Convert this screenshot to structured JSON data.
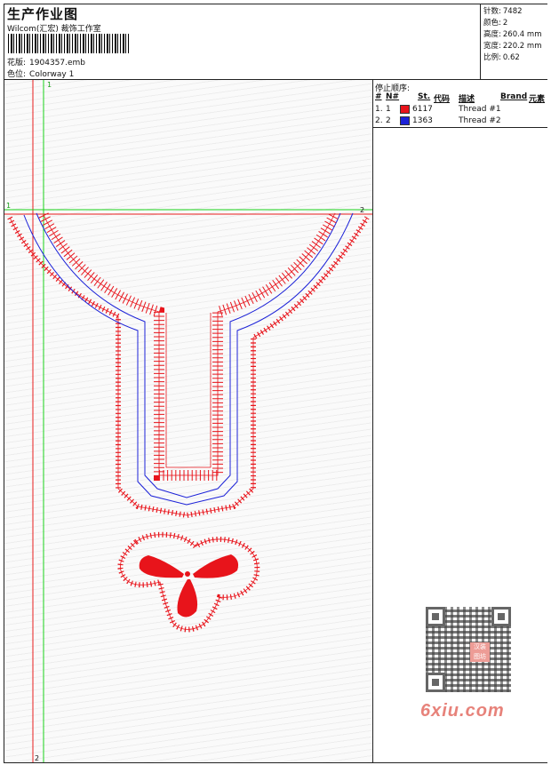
{
  "header": {
    "title": "生产作业图",
    "company": "Wilcom(汇宏) 裁饰工作室",
    "design_label": "花版:",
    "design_value": "1904357.emb",
    "colorway_label": "色位:",
    "colorway_value": "Colorway 1"
  },
  "stats": [
    {
      "label": "针数:",
      "value": "7482"
    },
    {
      "label": "颜色:",
      "value": "2"
    },
    {
      "label": "高度:",
      "value": "260.4 mm"
    },
    {
      "label": "宽度:",
      "value": "220.2 mm"
    },
    {
      "label": "比例:",
      "value": "0.62"
    }
  ],
  "stop_sequence": {
    "title": "停止顺序:",
    "columns": [
      "#",
      "N#",
      "St.",
      "代码",
      "描述",
      "Brand",
      "元素"
    ],
    "rows": [
      {
        "num": "1.",
        "needle": "1",
        "code": "6117",
        "description": "Thread #1",
        "color": "#e8141b"
      },
      {
        "num": "2.",
        "needle": "2",
        "code": "1363",
        "description": "Thread #2",
        "color": "#1c22d8"
      }
    ]
  },
  "guides": {
    "v1": "1",
    "v2": "2",
    "h1": "1",
    "h2": "2"
  },
  "watermark": {
    "stamp": "汉装 图坊",
    "text": "6xiu.com"
  },
  "colors": {
    "thread_red": "#e8141b",
    "thread_blue": "#1c22d8",
    "guide_green": "#19d219",
    "guide_red": "#e81c1c"
  }
}
